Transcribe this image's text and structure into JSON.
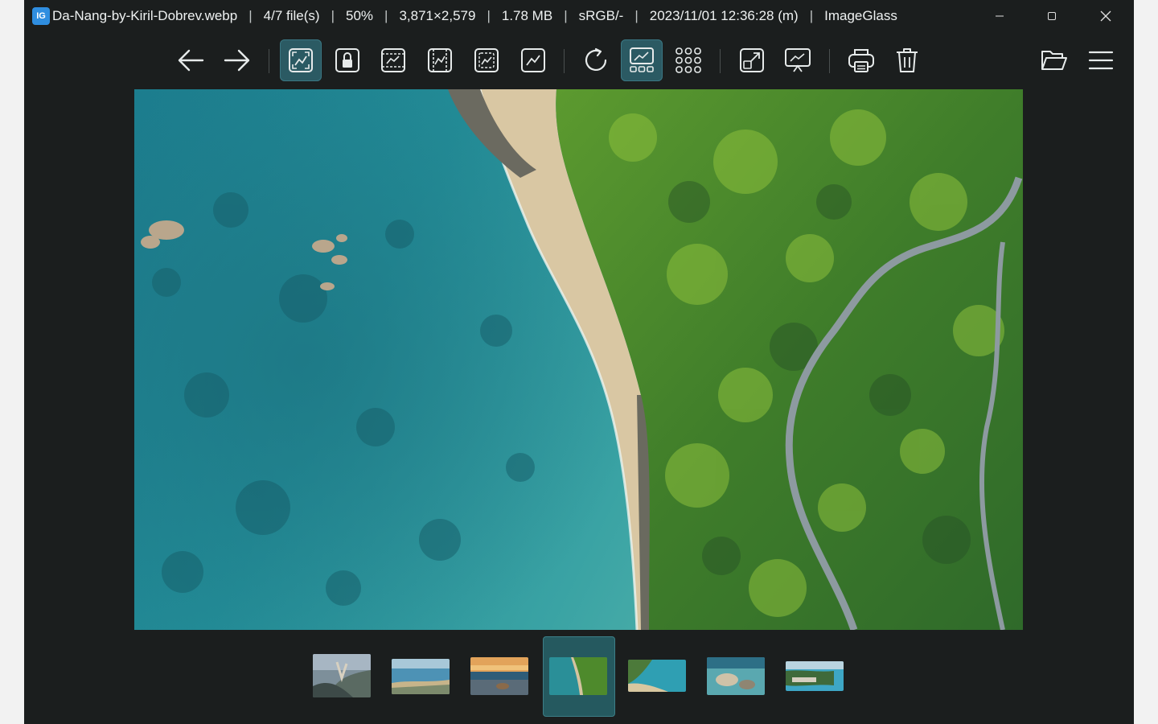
{
  "titlebar": {
    "app_icon_text": "IG",
    "file_name": "Da-Nang-by-Kiril-Dobrev.webp",
    "file_count": "4/7 file(s)",
    "zoom": "50%",
    "dimensions": "3,871×2,579",
    "file_size": "1.78 MB",
    "color_profile": "sRGB/-",
    "date_modified": "2023/11/01 12:36:28 (m)",
    "app_name": "ImageGlass",
    "separator": "|"
  },
  "toolbar": {
    "buttons": [
      {
        "name": "previous-image",
        "icon": "arrow-left-icon"
      },
      {
        "name": "next-image",
        "icon": "arrow-right-icon"
      },
      {
        "name": "auto-zoom",
        "icon": "auto-zoom-icon",
        "active": true
      },
      {
        "name": "lock-zoom",
        "icon": "lock-zoom-icon"
      },
      {
        "name": "scale-to-width",
        "icon": "scale-width-icon"
      },
      {
        "name": "scale-to-height",
        "icon": "scale-height-icon"
      },
      {
        "name": "scale-to-fit",
        "icon": "scale-fit-icon"
      },
      {
        "name": "scale-to-fill",
        "icon": "scale-fill-icon"
      },
      {
        "name": "refresh",
        "icon": "refresh-icon"
      },
      {
        "name": "toggle-gallery",
        "icon": "gallery-icon",
        "active": true
      },
      {
        "name": "toggle-checkerboard",
        "icon": "grid-dots-icon"
      },
      {
        "name": "full-screen",
        "icon": "fullscreen-icon"
      },
      {
        "name": "slideshow",
        "icon": "slideshow-icon"
      },
      {
        "name": "print",
        "icon": "print-icon"
      },
      {
        "name": "delete",
        "icon": "trash-icon"
      },
      {
        "name": "open-file",
        "icon": "folder-open-icon"
      },
      {
        "name": "main-menu",
        "icon": "hamburger-menu-icon"
      }
    ]
  },
  "gallery": {
    "count": 7,
    "selected_index": 3
  },
  "colors": {
    "window_bg": "#1b1e1e",
    "accent": "#2b5a63",
    "text": "#eef1f1"
  }
}
